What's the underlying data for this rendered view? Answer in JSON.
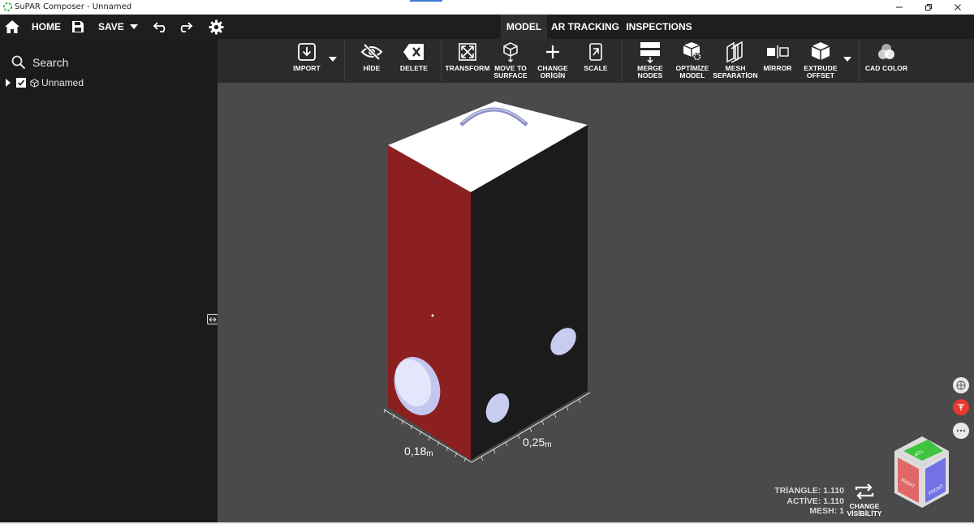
{
  "window": {
    "title": "SuPAR Composer - Unnamed"
  },
  "nav": {
    "home_label": "HOME",
    "save_label": "SAVE",
    "tabs": [
      {
        "label": "MODEL",
        "active": true
      },
      {
        "label": "AR TRACKING",
        "active": false
      },
      {
        "label": "INSPECTIONS",
        "active": false
      }
    ]
  },
  "sidebar": {
    "search_label": "Search",
    "tree": [
      {
        "label": "Unnamed",
        "checked": true
      }
    ]
  },
  "toolbar": {
    "import": "IMPORT",
    "hide": "HİDE",
    "delete": "DELETE",
    "transform": "TRANSFORM",
    "move_line1": "MOVE TO",
    "move_line2": "SURFACE",
    "origin_line1": "CHANGE",
    "origin_line2": "ORİGİN",
    "scale": "SCALE",
    "merge_line1": "MERGE",
    "merge_line2": "NODES",
    "optimize_line1": "OPTİMİZE",
    "optimize_line2": "MODEL",
    "mesh_line1": "MESH",
    "mesh_line2": "SEPARATİON",
    "mirror": "MİRROR",
    "extrude_line1": "EXTRUDE",
    "extrude_line2": "OFFSET",
    "cad_color": "CAD COLOR"
  },
  "viewport": {
    "dimensions": {
      "width_value": "0,18",
      "depth_value": "0,25",
      "unit": "m"
    },
    "stats": {
      "triangle": "TRİANGLE: 1.110",
      "active": "ACTİVE: 1.110",
      "mesh": "MESH: 1"
    },
    "change_visibility_line1": "CHANGE",
    "change_visibility_line2": "VİSİBİLİTY",
    "view_cube": {
      "top": "TOP",
      "right": "RIGHT",
      "front": "FRONT"
    }
  },
  "colors": {
    "face_top": "#ffffff",
    "face_left": "#8b1e1e",
    "face_right": "#1a1a1a",
    "hole": "#c8ccf0",
    "viewport_bg": "#4a4a4a"
  }
}
